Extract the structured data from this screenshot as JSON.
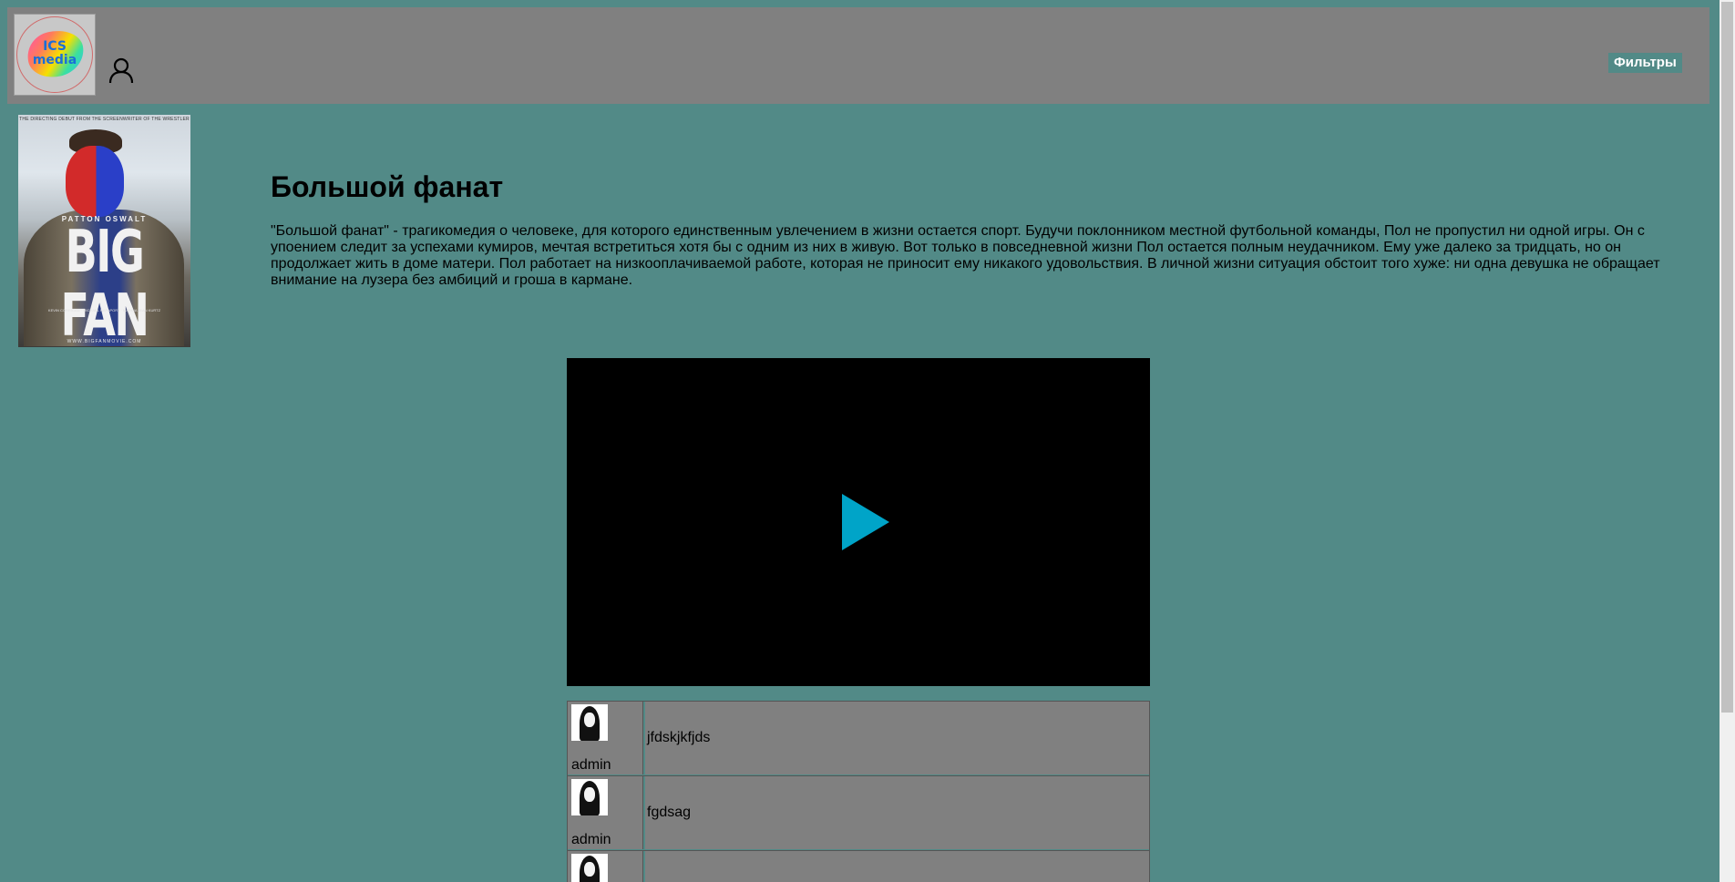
{
  "header": {
    "logo_text": "ICS\nmedia",
    "filter_button_label": "Фильтры"
  },
  "poster": {
    "tagline": "THE DIRECTING DEBUT FROM THE SCREENWRITER OF THE WRESTLER",
    "actor": "PATTON OSWALT",
    "title": "BIG FAN",
    "credits": "KEVIN CORRIGAN · MICHAEL RAPAPORT · MARCIA JEAN KURTZ",
    "url": "WWW.BIGFANMOVIE.COM"
  },
  "movie": {
    "title": "Большой фанат",
    "description": "\"Большой фанат\" - трагикомедия о человеке, для которого единственным увлечением в жизни остается спорт. Будучи поклонником местной футбольной команды, Пол не пропустил ни одной игры. Он с упоением следит за успехами кумиров, мечтая встретиться хотя бы с одним из них в живую. Вот только в повседневной жизни Пол остается полным неудачником. Ему уже далеко за тридцать, но он продолжает жить в доме матери. Пол работает на низкооплачиваемой работе, которая не приносит ему никакого удовольствия. В личной жизни ситуация обстоит того хуже: ни одна девушка не обращает внимание на лузера без амбиций и гроша в кармане."
  },
  "video": {
    "play_color": "#00a4c8"
  },
  "comments": [
    {
      "author": "admin",
      "text": "jfdskjkfjds"
    },
    {
      "author": "admin",
      "text": "fgdsag"
    },
    {
      "author": "",
      "text": ""
    }
  ],
  "colors": {
    "background": "#528a87",
    "header": "#808080",
    "comment_bg": "#808080"
  }
}
